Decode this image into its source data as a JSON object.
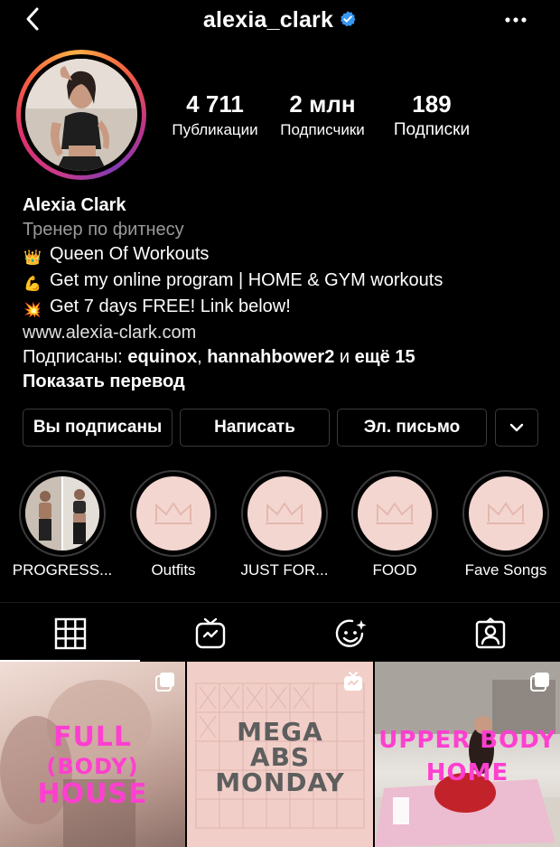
{
  "header": {
    "username": "alexia_clark"
  },
  "stats": [
    {
      "value": "4 711",
      "label": "Публикации"
    },
    {
      "value": "2 млн",
      "label": "Подписчики"
    },
    {
      "value": "189",
      "label": "Подписки"
    }
  ],
  "bio": {
    "name": "Alexia Clark",
    "category": "Тренер по фитнесу",
    "lines": [
      {
        "emoji": "👑",
        "text": "Queen Of Workouts"
      },
      {
        "emoji": "💪",
        "text": "Get my online program | HOME & GYM workouts"
      },
      {
        "emoji": "💥",
        "text": "Get 7 days FREE! Link below!"
      }
    ],
    "website": "www.alexia-clark.com",
    "followed_by_prefix": "Подписаны:",
    "followed_by_user1": "equinox",
    "followed_by_sep": ",",
    "followed_by_user2": "hannahbower2",
    "followed_by_and": "и",
    "followed_by_more": "ещё 15",
    "translate": "Показать перевод"
  },
  "buttons": {
    "following": "Вы подписаны",
    "message": "Написать",
    "email": "Эл. письмо"
  },
  "highlights": [
    {
      "label": "PROGRESS..."
    },
    {
      "label": "Outfits"
    },
    {
      "label": "JUST FOR..."
    },
    {
      "label": "FOOD"
    },
    {
      "label": "Fave Songs"
    }
  ],
  "tabs": {
    "icons": [
      "grid-icon",
      "igtv-icon",
      "effects-icon",
      "tagged-icon"
    ],
    "active": "grid-icon"
  },
  "posts": [
    {
      "lines": [
        "FULL",
        "(BODY)",
        "HOUSE"
      ]
    },
    {
      "lines": [
        "MEGA",
        "ABS",
        "MONDAY"
      ]
    },
    {
      "lines": [
        "UPPER BODY",
        "HOME"
      ]
    }
  ],
  "colors": {
    "background": "#000000",
    "verified": "#3897f0",
    "secondary_text": "#9a9a9a",
    "post_pink_text": "#ff3fd0"
  }
}
